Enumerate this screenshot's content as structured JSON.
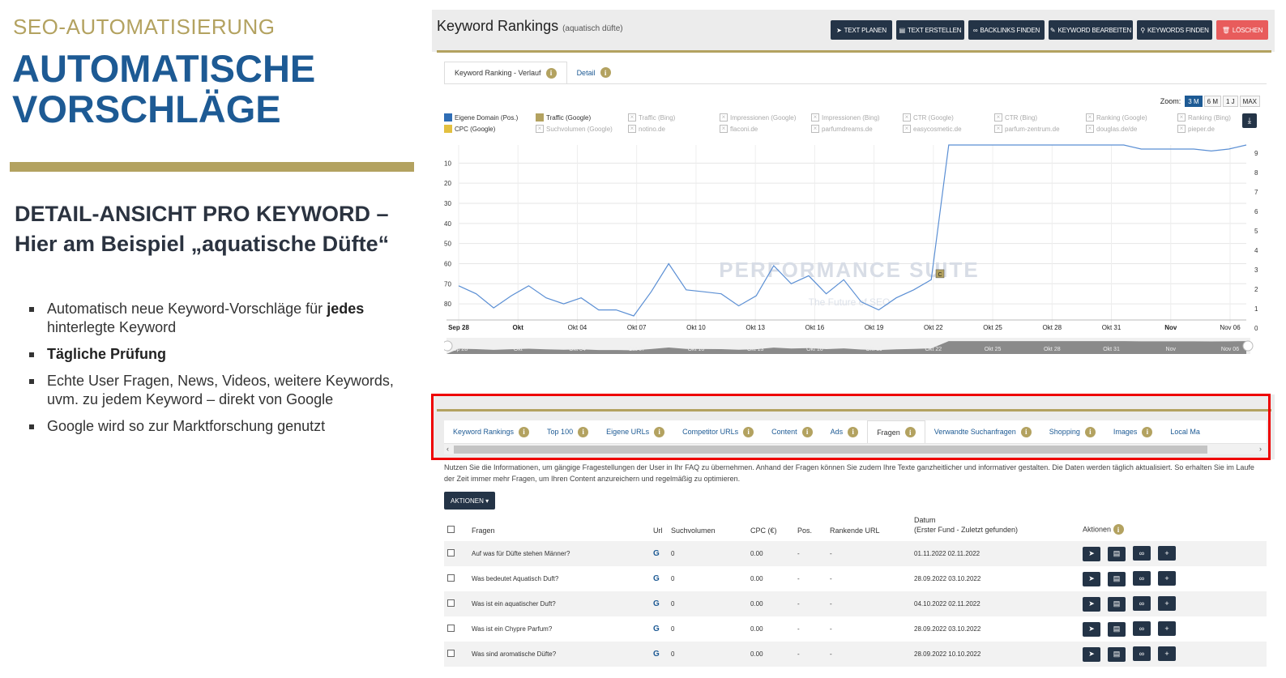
{
  "slide": {
    "eyebrow": "SEO-AUTOMATISIERUNG",
    "headline_line1": "AUTOMATISCHE",
    "headline_line2": "VORSCHLÄGE",
    "subhead_line1": "DETAIL-ANSICHT PRO KEYWORD –",
    "subhead_line2": "Hier am Beispiel „aquatische Düfte“",
    "bullets": [
      {
        "pre": "Automatisch neue Keyword-Vorschläge für ",
        "bold": "jedes",
        "post": " hinterlegte Keyword"
      },
      {
        "pre": "",
        "bold": "Tägliche Prüfung",
        "post": ""
      },
      {
        "pre": "Echte User Fragen, News, Videos, weitere Keywords, uvm. zu jedem Keyword – direkt von Google",
        "bold": "",
        "post": ""
      },
      {
        "pre": "Google wird so zur Marktforschung genutzt",
        "bold": "",
        "post": ""
      }
    ],
    "colors": {
      "gold": "#b3a260",
      "blue": "#1d5a94"
    }
  },
  "app": {
    "title": "Keyword Rankings",
    "keyword": "(aquatisch düfte)",
    "toolbar": [
      {
        "label": "TEXT PLANEN",
        "icon": "paper-plane-icon",
        "glyph": "➤"
      },
      {
        "label": "TEXT ERSTELLEN",
        "icon": "book-icon",
        "glyph": "▤"
      },
      {
        "label": "BACKLINKS FINDEN",
        "icon": "link-icon",
        "glyph": "∞"
      },
      {
        "label": "KEYWORD BEARBEITEN",
        "icon": "edit-icon",
        "glyph": "✎"
      },
      {
        "label": "KEYWORDS FINDEN",
        "icon": "search-icon",
        "glyph": "⚲"
      },
      {
        "label": "LÖSCHEN",
        "icon": "trash-icon",
        "glyph": "🗑"
      }
    ],
    "chart_tabs": [
      {
        "label": "Keyword Ranking - Verlauf"
      },
      {
        "label": "Detail"
      }
    ],
    "zoom": {
      "label": "Zoom:",
      "options": [
        "3 M",
        "6 M",
        "1 J",
        "MAX"
      ],
      "selected": "3 M"
    },
    "legend": [
      {
        "label": "Eigene Domain (Pos.)",
        "color": "#2f6db5",
        "on": true
      },
      {
        "label": "Traffic (Google)",
        "color": "#b3a260",
        "on": true
      },
      {
        "label": "Traffic (Bing)",
        "on": false
      },
      {
        "label": "Impressionen (Google)",
        "on": false
      },
      {
        "label": "Impressionen (Bing)",
        "on": false
      },
      {
        "label": "CTR (Google)",
        "on": false
      },
      {
        "label": "CTR (Bing)",
        "on": false
      },
      {
        "label": "Ranking (Google)",
        "on": false
      },
      {
        "label": "Ranking (Bing)",
        "on": false
      },
      {
        "label": "CPC (Google)",
        "color": "#e3c040",
        "on": true
      },
      {
        "label": "Suchvolumen (Google)",
        "on": false
      },
      {
        "label": "notino.de",
        "on": false
      },
      {
        "label": "flaconi.de",
        "on": false
      },
      {
        "label": "parfumdreams.de",
        "on": false
      },
      {
        "label": "easycosmetic.de",
        "on": false
      },
      {
        "label": "parfum-zentrum.de",
        "on": false
      },
      {
        "label": "douglas.de/de",
        "on": false
      },
      {
        "label": "pieper.de",
        "on": false
      }
    ],
    "watermark": {
      "title": "PERFORMANCE SUITE",
      "tagline": "The Future of SEO"
    },
    "section_tabs": [
      {
        "label": "Keyword Rankings",
        "active": false
      },
      {
        "label": "Top 100",
        "active": false
      },
      {
        "label": "Eigene URLs",
        "active": false
      },
      {
        "label": "Competitor URLs",
        "active": false
      },
      {
        "label": "Content",
        "active": false
      },
      {
        "label": "Ads",
        "active": false
      },
      {
        "label": "Fragen",
        "active": true
      },
      {
        "label": "Verwandte Suchanfragen",
        "active": false
      },
      {
        "label": "Shopping",
        "active": false
      },
      {
        "label": "Images",
        "active": false
      },
      {
        "label": "Local Ma",
        "active": false
      }
    ],
    "description": "Nutzen Sie die Informationen, um gängige Fragestellungen der User in Ihr FAQ zu übernehmen. Anhand der Fragen können Sie zudem Ihre Texte ganzheitlicher und informativer gestalten. Die Daten werden täglich aktualisiert. So erhalten Sie im Laufe der Zeit immer mehr Fragen, um Ihren Content anzureichern und regelmäßig zu optimieren.",
    "actions_button": "AKTIONEN ▾",
    "table": {
      "headers": {
        "question": "Fragen",
        "url": "Url",
        "volume": "Suchvolumen",
        "cpc": "CPC (€)",
        "pos": "Pos.",
        "rank_url": "Rankende URL",
        "date1": "Datum",
        "date2": "(Erster Fund - Zuletzt gefunden)",
        "actions": "Aktionen"
      },
      "rows": [
        {
          "q": "Auf was für Düfte stehen Männer?",
          "url": "G",
          "vol": "0",
          "cpc": "0.00",
          "pos": "-",
          "rank": "-",
          "date": "01.11.2022 02.11.2022"
        },
        {
          "q": "Was bedeutet Aquatisch Duft?",
          "url": "G",
          "vol": "0",
          "cpc": "0.00",
          "pos": "-",
          "rank": "-",
          "date": "28.09.2022 03.10.2022"
        },
        {
          "q": "Was ist ein aquatischer Duft?",
          "url": "G",
          "vol": "0",
          "cpc": "0.00",
          "pos": "-",
          "rank": "-",
          "date": "04.10.2022 02.11.2022"
        },
        {
          "q": "Was ist ein Chypre Parfum?",
          "url": "G",
          "vol": "0",
          "cpc": "0.00",
          "pos": "-",
          "rank": "-",
          "date": "28.09.2022 03.10.2022"
        },
        {
          "q": "Was sind aromatische Düfte?",
          "url": "G",
          "vol": "0",
          "cpc": "0.00",
          "pos": "-",
          "rank": "-",
          "date": "28.09.2022 10.10.2022"
        }
      ]
    }
  },
  "chart_data": {
    "type": "line",
    "x_ticks": [
      "Sep 28",
      "Okt",
      "Okt 04",
      "Okt 07",
      "Okt 10",
      "Okt 13",
      "Okt 16",
      "Okt 19",
      "Okt 22",
      "Okt 25",
      "Okt 28",
      "Okt 31",
      "Nov",
      "Nov 06"
    ],
    "y_left_ticks": [
      "10",
      "20",
      "30",
      "40",
      "50",
      "60",
      "70",
      "80"
    ],
    "y_right_ticks": [
      "9",
      "8",
      "7",
      "6",
      "5",
      "4",
      "3",
      "2",
      "1",
      "0"
    ],
    "y_left_range": [
      1,
      88
    ],
    "y_right_range": [
      0,
      9
    ],
    "series": [
      {
        "name": "Eigene Domain (Pos.)",
        "color": "#5b8fd4",
        "values": [
          71,
          75,
          82,
          76,
          71,
          77,
          80,
          77,
          83,
          83,
          86,
          74,
          60,
          73,
          74,
          75,
          81,
          76,
          61,
          70,
          66,
          75,
          68,
          79,
          83,
          77,
          73,
          68,
          1,
          1,
          1,
          1,
          1,
          1,
          1,
          1,
          1,
          1,
          1,
          3,
          3,
          3,
          3,
          4,
          3,
          1
        ]
      }
    ],
    "annotation": {
      "label": "C",
      "color": "#b3a260"
    }
  }
}
